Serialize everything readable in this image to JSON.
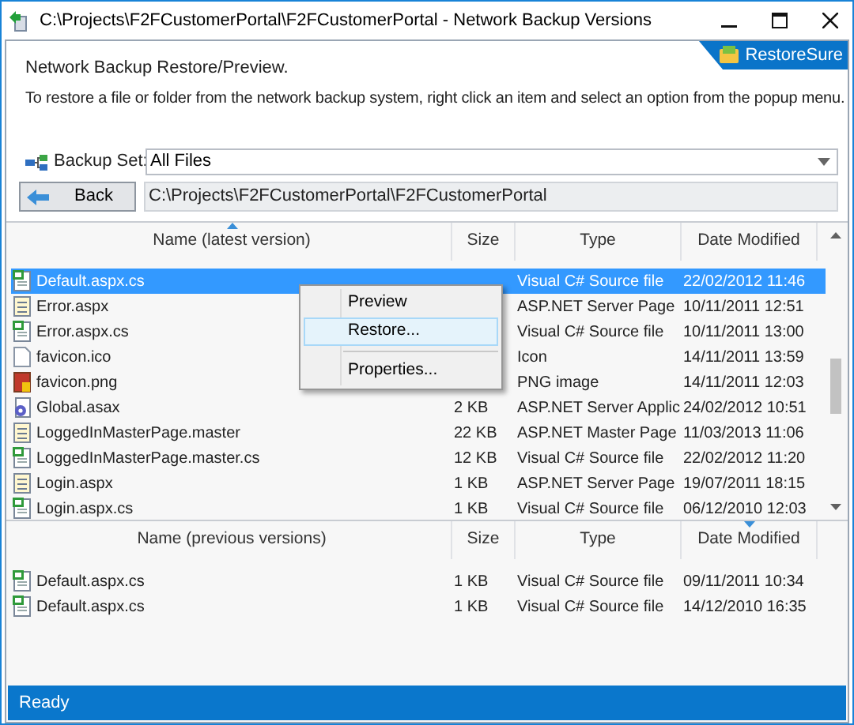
{
  "window": {
    "title": "C:\\Projects\\F2FCustomerPortal\\F2FCustomerPortal - Network Backup Versions"
  },
  "header": {
    "brand": "RestoreSure",
    "heading": "Network Backup Restore/Preview.",
    "instructions": "To restore a file or folder from the network backup system, right click an item and select an option from the popup menu."
  },
  "backup_set": {
    "label": "Backup Set:",
    "value": "All Files"
  },
  "navigation": {
    "back_button": "Back",
    "path": "C:\\Projects\\F2FCustomerPortal\\F2FCustomerPortal"
  },
  "latest_versions": {
    "columns": [
      {
        "label": "Name (latest version)",
        "sorted": true
      },
      {
        "label": "Size",
        "sorted": false
      },
      {
        "label": "Type",
        "sorted": false
      },
      {
        "label": "Date Modified",
        "sorted": false
      }
    ],
    "rows": [
      {
        "kind": "csharp",
        "name": "Default.aspx.cs",
        "type": "Visual C# Source file",
        "date": "22/02/2012 11:46",
        "selected": true
      },
      {
        "kind": "page",
        "name": "Error.aspx",
        "type": "ASP.NET Server Page",
        "date": "10/11/2011 12:51",
        "selected": false
      },
      {
        "kind": "csharp",
        "name": "Error.aspx.cs",
        "type": "Visual C# Source file",
        "date": "10/11/2011 13:00",
        "selected": false
      },
      {
        "kind": "blank",
        "name": "favicon.ico",
        "type": "Icon",
        "date": "14/11/2011 13:59",
        "selected": false
      },
      {
        "kind": "image",
        "name": "favicon.png",
        "type": "PNG image",
        "date": "14/11/2011 12:03",
        "selected": false
      },
      {
        "kind": "gear",
        "name": "Global.asax",
        "size": "2 KB",
        "type": "ASP.NET Server Applic",
        "date": "24/02/2012 10:51",
        "selected": false
      },
      {
        "kind": "page",
        "name": "LoggedInMasterPage.master",
        "size": "22 KB",
        "type": "ASP.NET Master Page",
        "date": "11/03/2013 11:06",
        "selected": false
      },
      {
        "kind": "csharp",
        "name": "LoggedInMasterPage.master.cs",
        "size": "12 KB",
        "type": "Visual C# Source file",
        "date": "22/02/2012 11:20",
        "selected": false
      },
      {
        "kind": "page",
        "name": "Login.aspx",
        "size": "1 KB",
        "type": "ASP.NET Server Page",
        "date": "19/07/2011 18:15",
        "selected": false
      },
      {
        "kind": "csharp",
        "name": "Login.aspx.cs",
        "size": "1 KB",
        "type": "Visual C# Source file",
        "date": "06/12/2010 12:03",
        "selected": false
      }
    ]
  },
  "context_menu": {
    "items": [
      {
        "label": "Preview",
        "hovered": false,
        "separator_before": false
      },
      {
        "label": "Restore...",
        "hovered": true,
        "separator_before": false
      },
      {
        "label": "Properties...",
        "hovered": false,
        "separator_before": true
      }
    ]
  },
  "previous_versions": {
    "columns": [
      {
        "label": "Name (previous versions)",
        "sorted": false
      },
      {
        "label": "Size",
        "sorted": false
      },
      {
        "label": "Type",
        "sorted": false
      },
      {
        "label": "Date Modified",
        "sorted": true
      }
    ],
    "rows": [
      {
        "kind": "csharp",
        "name": "Default.aspx.cs",
        "size": "1 KB",
        "type": "Visual C# Source file",
        "date": "09/11/2011 10:34",
        "selected": false
      },
      {
        "kind": "csharp",
        "name": "Default.aspx.cs",
        "size": "1 KB",
        "type": "Visual C# Source file",
        "date": "14/12/2010 16:35",
        "selected": false
      }
    ]
  },
  "status_bar": {
    "text": "Ready"
  }
}
